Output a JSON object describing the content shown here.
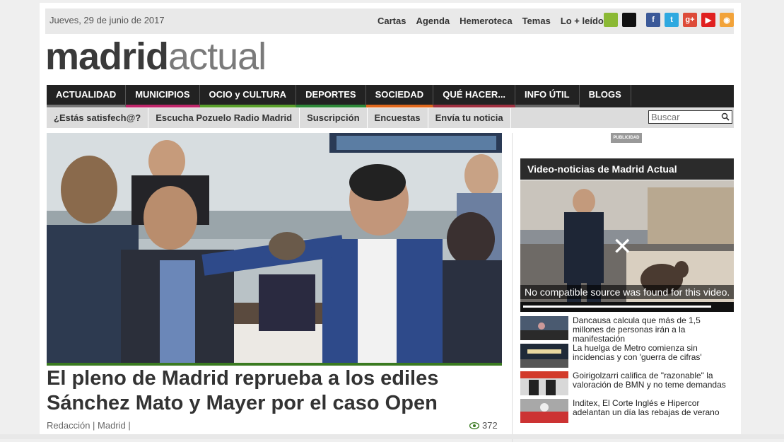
{
  "header": {
    "date": "Jueves, 29 de junio de 2017",
    "links": [
      "Cartas",
      "Agenda",
      "Hemeroteca",
      "Temas",
      "Lo + leído"
    ],
    "social": [
      {
        "name": "android-icon",
        "glyph": "",
        "color": "#8bb935"
      },
      {
        "name": "apple-icon",
        "glyph": "",
        "color": "#111111"
      },
      {
        "name": "facebook-icon",
        "glyph": "f",
        "color": "#3b5998"
      },
      {
        "name": "twitter-icon",
        "glyph": "t",
        "color": "#2fa9e0"
      },
      {
        "name": "google-plus-icon",
        "glyph": "g+",
        "color": "#dd4b39"
      },
      {
        "name": "youtube-icon",
        "glyph": "▶",
        "color": "#e02020"
      },
      {
        "name": "rss-icon",
        "glyph": "◉",
        "color": "#f2a33a"
      }
    ]
  },
  "logo": {
    "part1": "madrid",
    "part2": "actual"
  },
  "nav": [
    {
      "label": "ACTUALIDAD",
      "color": "#777777"
    },
    {
      "label": "MUNICIPIOS",
      "color": "#c0266a"
    },
    {
      "label": "OCIO y CULTURA",
      "color": "#5aa02c"
    },
    {
      "label": "DEPORTES",
      "color": "#2f8a3a"
    },
    {
      "label": "SOCIEDAD",
      "color": "#e0681d"
    },
    {
      "label": "QUÉ HACER...",
      "color": "#a03040"
    },
    {
      "label": "INFO ÚTIL",
      "color": "#666666"
    },
    {
      "label": "BLOGS",
      "color": "#222222"
    }
  ],
  "subnav": [
    "¿Estás satisfech@?",
    "Escucha Pozuelo Radio Madrid",
    "Suscripción",
    "Encuestas",
    "Envía tu noticia"
  ],
  "search": {
    "placeholder": "Buscar"
  },
  "article": {
    "headline": "El pleno de Madrid reprueba a los ediles Sánchez Mato y Mayer por el caso Open",
    "byline": "Redacción | Madrid |",
    "views": "372"
  },
  "sidebar": {
    "ad_label": "PUBLICIDAD",
    "video_title": "Video-noticias de Madrid Actual",
    "video_error": "No compatible source was found for this video.",
    "news": [
      "Dancausa calcula que más de 1,5 millones de personas irán a la manifestación",
      "La huelga de Metro comienza sin incidencias y con 'guerra de cifras'",
      "Goirigolzarri califica de \"razonable\" la valoración de BMN y no teme demandas",
      "Inditex, El Corte Inglés e Hipercor adelantan un día las rebajas de verano"
    ]
  },
  "colors": {
    "accent_green": "#3a7a20",
    "nav_bg": "#222222"
  }
}
